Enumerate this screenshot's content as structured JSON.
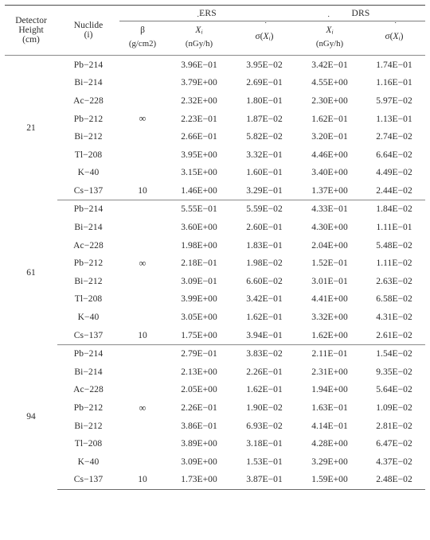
{
  "table": {
    "columns": {
      "height": {
        "lines": [
          "Detector",
          "Height",
          "(cm)"
        ]
      },
      "nuclide": {
        "lines": [
          "Nuclide",
          "(i)"
        ]
      },
      "beta": {
        "symbol": "β",
        "unit": "(g/cm2)"
      },
      "ers_group": "ERS",
      "drs_group": "DRS",
      "ers_rate": {
        "symbol": "X",
        "dot": "˙",
        "subscript": "i",
        "unit": "(nGy/h)"
      },
      "ers_sigma": {
        "prefix": "σ(",
        "symbol": "X",
        "dot": "˙",
        "subscript": "i",
        "suffix": ")"
      },
      "drs_rate": {
        "symbol": "X",
        "dot": "˙",
        "subscript": "i",
        "unit": "(nGy/h)"
      },
      "drs_sigma": {
        "prefix": "σ(",
        "symbol": "X",
        "dot": "˙",
        "subscript": "i",
        "suffix": ")"
      }
    },
    "beta_values": {
      "infinity": "∞",
      "cs137": "10"
    },
    "blocks": [
      {
        "height": "21",
        "rows": [
          {
            "nuclide": "Pb−214",
            "beta": "",
            "ers_x": "3.96E−01",
            "ers_s": "3.95E−02",
            "drs_x": "3.42E−01",
            "drs_s": "1.74E−01"
          },
          {
            "nuclide": "Bi−214",
            "beta": "",
            "ers_x": "3.79E+00",
            "ers_s": "2.69E−01",
            "drs_x": "4.55E+00",
            "drs_s": "1.16E−01"
          },
          {
            "nuclide": "Ac−228",
            "beta": "",
            "ers_x": "2.32E+00",
            "ers_s": "1.80E−01",
            "drs_x": "2.30E+00",
            "drs_s": "5.97E−02"
          },
          {
            "nuclide": "Pb−212",
            "beta": "∞",
            "ers_x": "2.23E−01",
            "ers_s": "1.87E−02",
            "drs_x": "1.62E−01",
            "drs_s": "1.13E−01"
          },
          {
            "nuclide": "Bi−212",
            "beta": "",
            "ers_x": "2.66E−01",
            "ers_s": "5.82E−02",
            "drs_x": "3.20E−01",
            "drs_s": "2.74E−02"
          },
          {
            "nuclide": "Tl−208",
            "beta": "",
            "ers_x": "3.95E+00",
            "ers_s": "3.32E−01",
            "drs_x": "4.46E+00",
            "drs_s": "6.64E−02"
          },
          {
            "nuclide": "K−40",
            "beta": "",
            "ers_x": "3.15E+00",
            "ers_s": "1.60E−01",
            "drs_x": "3.40E+00",
            "drs_s": "4.49E−02"
          },
          {
            "nuclide": "Cs−137",
            "beta": "10",
            "ers_x": "1.46E+00",
            "ers_s": "3.29E−01",
            "drs_x": "1.37E+00",
            "drs_s": "2.44E−02"
          }
        ]
      },
      {
        "height": "61",
        "rows": [
          {
            "nuclide": "Pb−214",
            "beta": "",
            "ers_x": "5.55E−01",
            "ers_s": "5.59E−02",
            "drs_x": "4.33E−01",
            "drs_s": "1.84E−02"
          },
          {
            "nuclide": "Bi−214",
            "beta": "",
            "ers_x": "3.60E+00",
            "ers_s": "2.60E−01",
            "drs_x": "4.30E+00",
            "drs_s": "1.11E−01"
          },
          {
            "nuclide": "Ac−228",
            "beta": "",
            "ers_x": "1.98E+00",
            "ers_s": "1.83E−01",
            "drs_x": "2.04E+00",
            "drs_s": "5.48E−02"
          },
          {
            "nuclide": "Pb−212",
            "beta": "∞",
            "ers_x": "2.18E−01",
            "ers_s": "1.98E−02",
            "drs_x": "1.52E−01",
            "drs_s": "1.11E−02"
          },
          {
            "nuclide": "Bi−212",
            "beta": "",
            "ers_x": "3.09E−01",
            "ers_s": "6.60E−02",
            "drs_x": "3.01E−01",
            "drs_s": "2.63E−02"
          },
          {
            "nuclide": "Tl−208",
            "beta": "",
            "ers_x": "3.99E+00",
            "ers_s": "3.42E−01",
            "drs_x": "4.41E+00",
            "drs_s": "6.58E−02"
          },
          {
            "nuclide": "K−40",
            "beta": "",
            "ers_x": "3.05E+00",
            "ers_s": "1.62E−01",
            "drs_x": "3.32E+00",
            "drs_s": "4.31E−02"
          },
          {
            "nuclide": "Cs−137",
            "beta": "10",
            "ers_x": "1.75E+00",
            "ers_s": "3.94E−01",
            "drs_x": "1.62E+00",
            "drs_s": "2.61E−02"
          }
        ]
      },
      {
        "height": "94",
        "rows": [
          {
            "nuclide": "Pb−214",
            "beta": "",
            "ers_x": "2.79E−01",
            "ers_s": "3.83E−02",
            "drs_x": "2.11E−01",
            "drs_s": "1.54E−02"
          },
          {
            "nuclide": "Bi−214",
            "beta": "",
            "ers_x": "2.13E+00",
            "ers_s": "2.26E−01",
            "drs_x": "2.31E+00",
            "drs_s": "9.35E−02"
          },
          {
            "nuclide": "Ac−228",
            "beta": "",
            "ers_x": "2.05E+00",
            "ers_s": "1.62E−01",
            "drs_x": "1.94E+00",
            "drs_s": "5.64E−02"
          },
          {
            "nuclide": "Pb−212",
            "beta": "∞",
            "ers_x": "2.26E−01",
            "ers_s": "1.90E−02",
            "drs_x": "1.63E−01",
            "drs_s": "1.09E−02"
          },
          {
            "nuclide": "Bi−212",
            "beta": "",
            "ers_x": "3.86E−01",
            "ers_s": "6.93E−02",
            "drs_x": "4.14E−01",
            "drs_s": "2.81E−02"
          },
          {
            "nuclide": "Tl−208",
            "beta": "",
            "ers_x": "3.89E+00",
            "ers_s": "3.18E−01",
            "drs_x": "4.28E+00",
            "drs_s": "6.47E−02"
          },
          {
            "nuclide": "K−40",
            "beta": "",
            "ers_x": "3.09E+00",
            "ers_s": "1.53E−01",
            "drs_x": "3.29E+00",
            "drs_s": "4.37E−02"
          },
          {
            "nuclide": "Cs−137",
            "beta": "10",
            "ers_x": "1.73E+00",
            "ers_s": "3.87E−01",
            "drs_x": "1.59E+00",
            "drs_s": "2.48E−02"
          }
        ]
      }
    ]
  }
}
